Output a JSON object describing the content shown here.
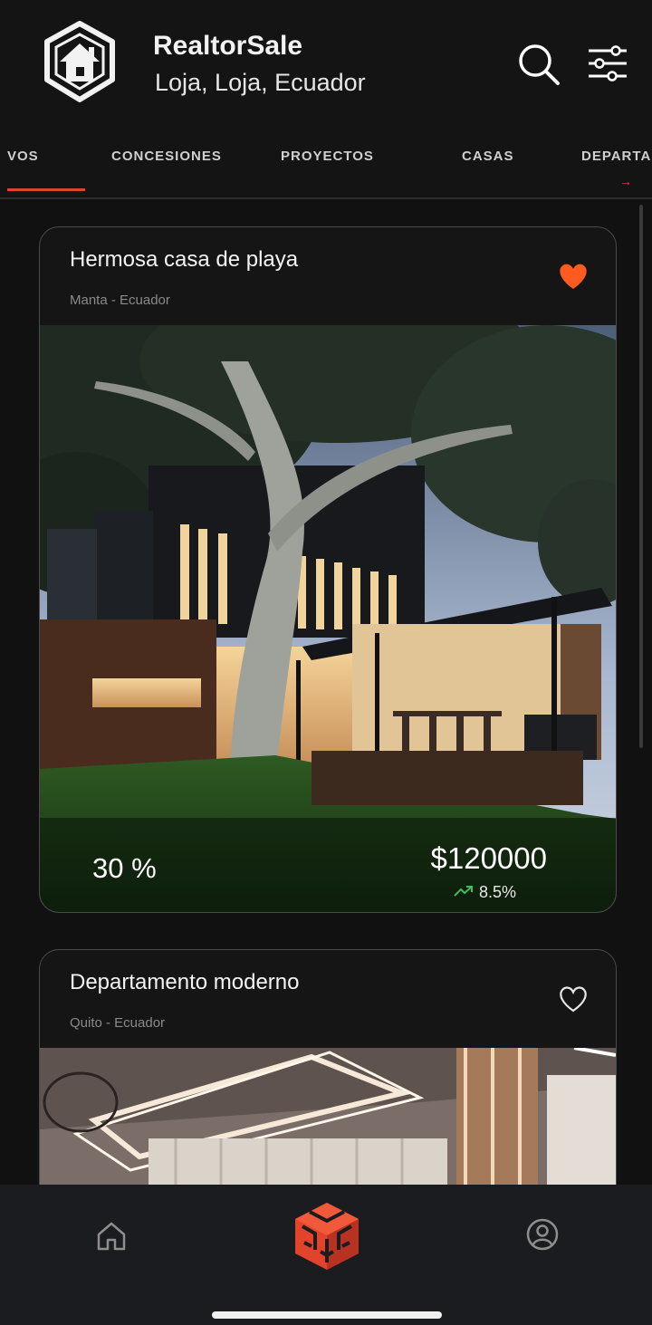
{
  "app": {
    "title": "RealtorSale",
    "location": "Loja, Loja, Ecuador",
    "accent_color": "#d9452f"
  },
  "header_icons": {
    "search": "search-icon",
    "filter": "filter-sliders-icon"
  },
  "tabs": [
    {
      "label": "VOS",
      "active": true
    },
    {
      "label": "CONCESIONES",
      "active": false
    },
    {
      "label": "PROYECTOS",
      "active": false
    },
    {
      "label": "CASAS",
      "active": false
    },
    {
      "label": "DEPARTA",
      "active": false
    }
  ],
  "listings": [
    {
      "title": "Hermosa casa de playa",
      "location": "Manta - Ecuador",
      "favorite": true,
      "percent": "30 %",
      "price": "$120000",
      "trend": "8.5%"
    },
    {
      "title": "Departamento moderno",
      "location": "Quito - Ecuador",
      "favorite": false
    }
  ],
  "bottom_nav": {
    "home": "home-icon",
    "center": "cube-logo-icon",
    "profile": "profile-icon"
  }
}
